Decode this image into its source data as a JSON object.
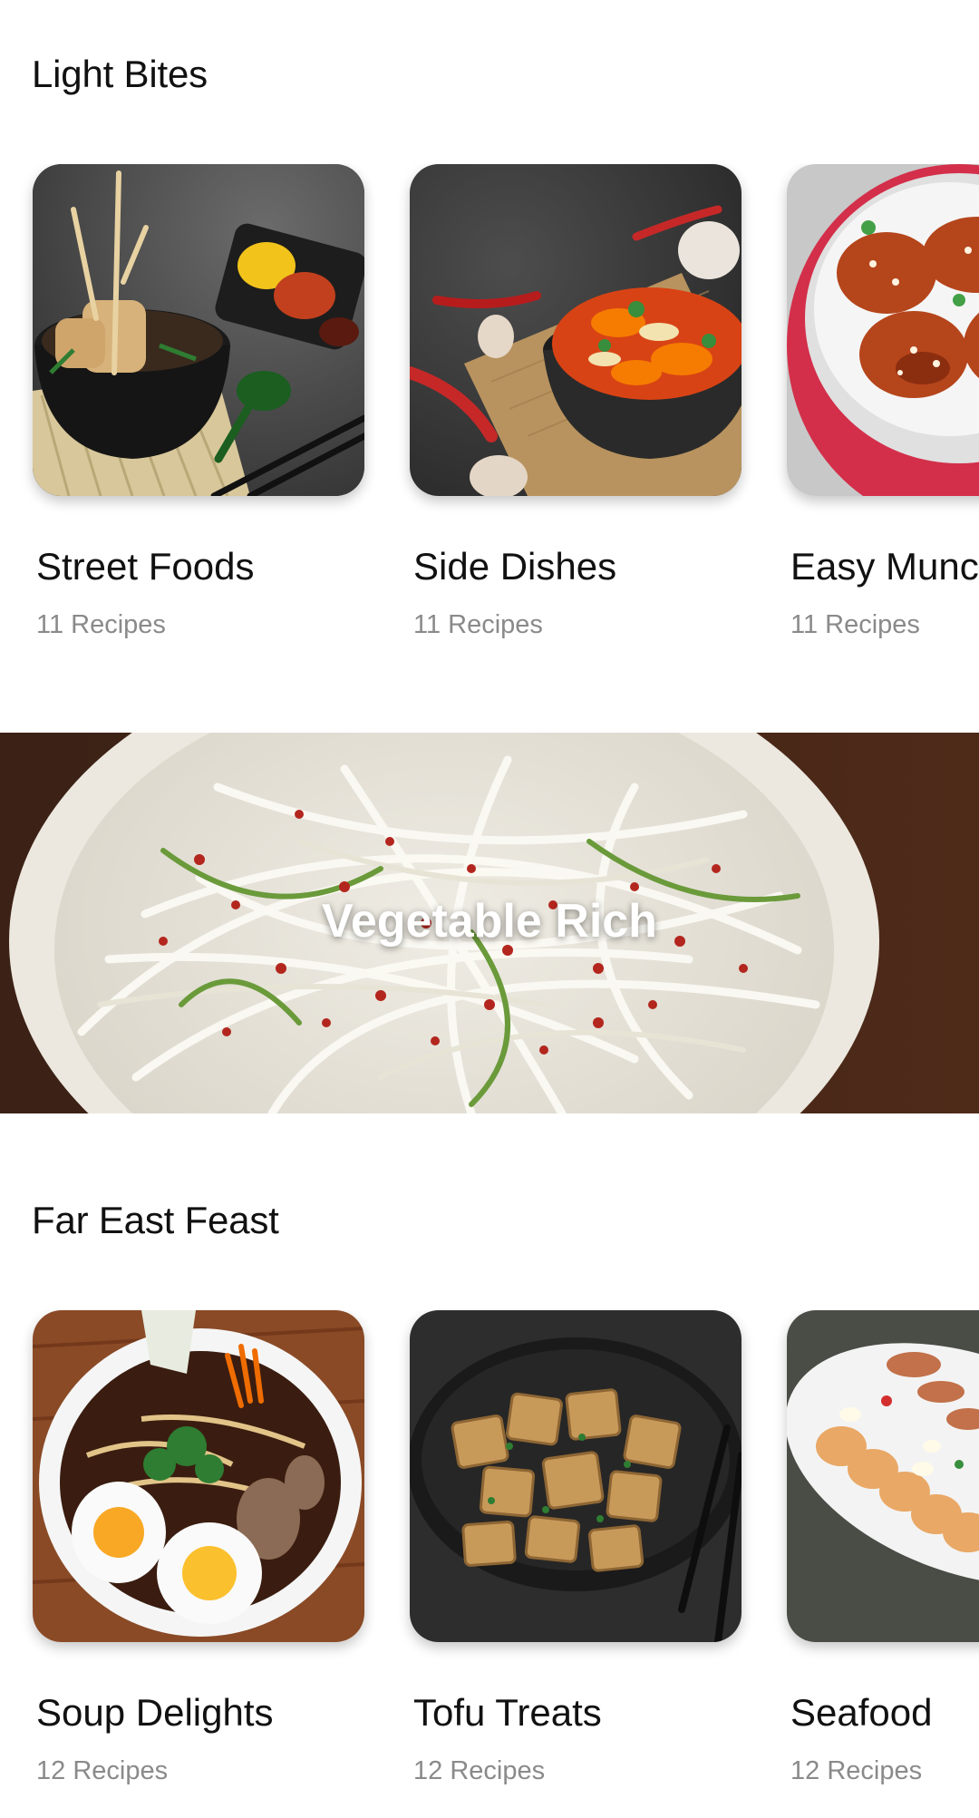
{
  "sections": [
    {
      "title": "Light Bites",
      "cards": [
        {
          "title": "Street Foods",
          "count": "11 Recipes"
        },
        {
          "title": "Side Dishes",
          "count": "11 Recipes"
        },
        {
          "title": "Easy Munchies",
          "count": "11 Recipes"
        }
      ]
    },
    {
      "title": "Far East Feast",
      "cards": [
        {
          "title": "Soup Delights",
          "count": "12 Recipes"
        },
        {
          "title": "Tofu Treats",
          "count": "12 Recipes"
        },
        {
          "title": "Seafood",
          "count": "12 Recipes"
        }
      ]
    }
  ],
  "banner": {
    "title": "Vegetable Rich"
  }
}
